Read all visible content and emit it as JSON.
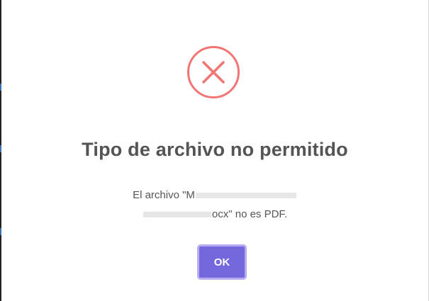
{
  "dialog": {
    "icon": "error-x-icon",
    "icon_color": "#f27474",
    "title": "Tipo de archivo no permitido",
    "message_line1_prefix": "El archivo \"M",
    "message_line2_suffix": "ocx\" no es PDF.",
    "ok_label": "OK",
    "accent_color": "#7466dc"
  }
}
